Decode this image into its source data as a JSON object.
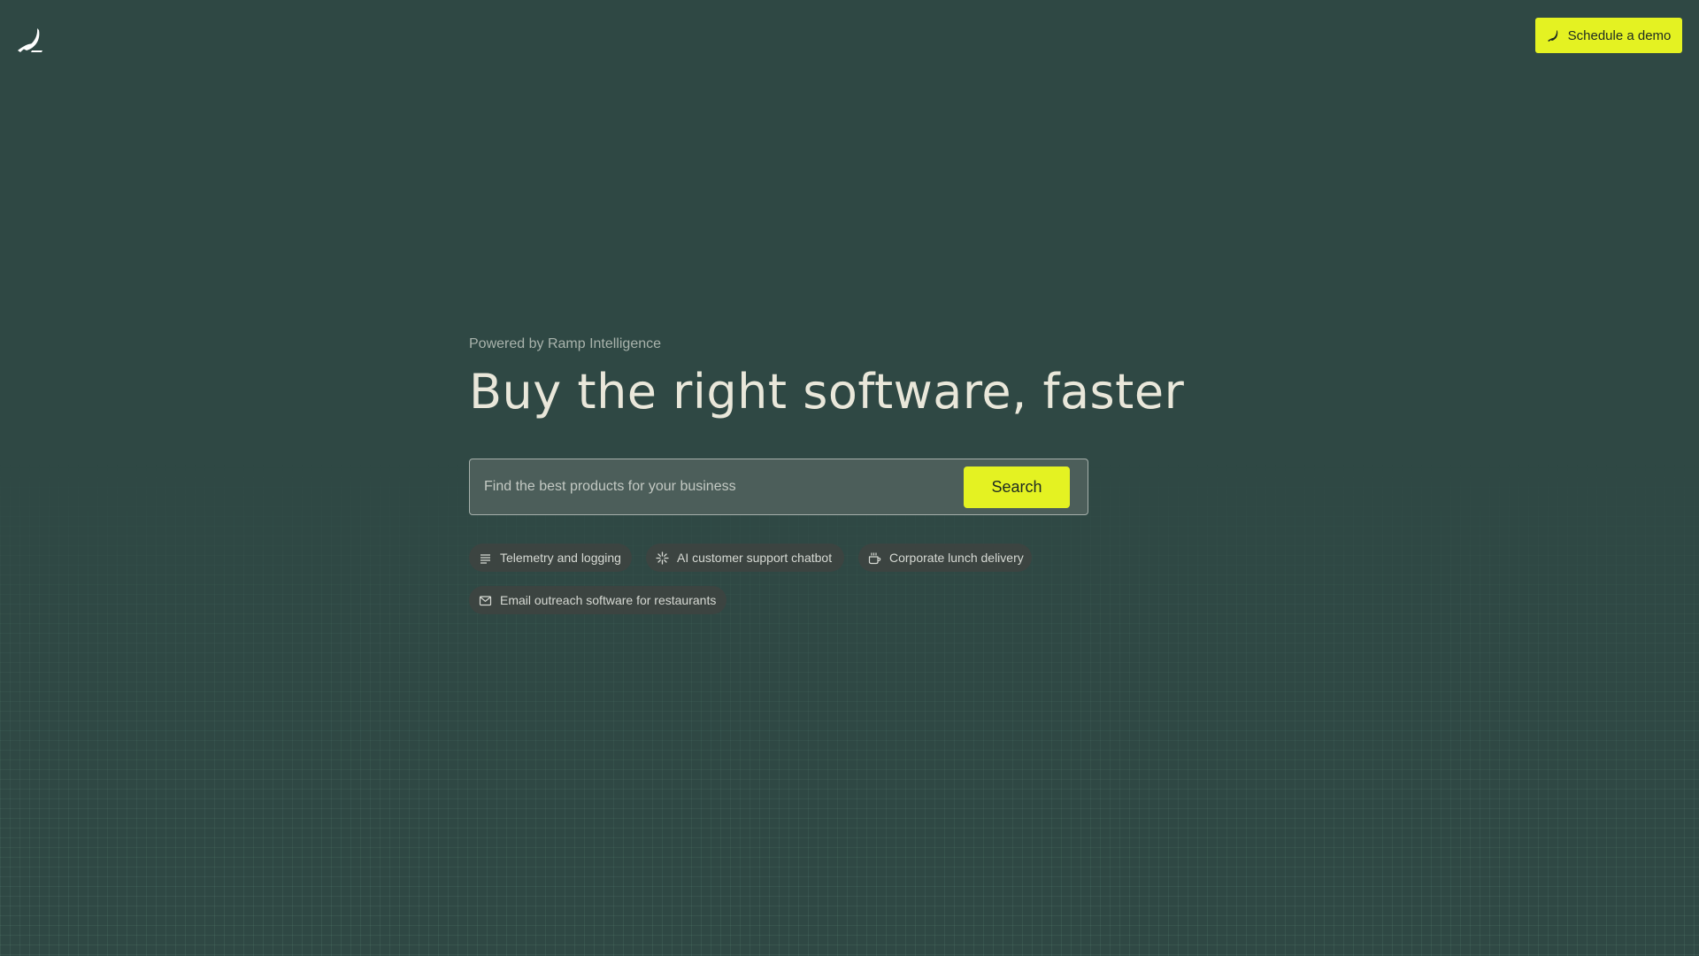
{
  "header": {
    "logo_icon": "ramp-logo-icon",
    "demo_button": {
      "label": "Schedule a demo",
      "icon": "ramp-logo-icon"
    }
  },
  "hero": {
    "powered_by": "Powered by Ramp Intelligence",
    "headline": "Buy the right software, faster"
  },
  "search": {
    "placeholder": "Find the best products for your business",
    "value": "",
    "button_label": "Search"
  },
  "suggestions": [
    {
      "label": "Telemetry and logging",
      "icon": "list-lines-icon"
    },
    {
      "label": "AI customer support chatbot",
      "icon": "sparkle-icon"
    },
    {
      "label": "Corporate lunch delivery",
      "icon": "takeout-cup-icon"
    },
    {
      "label": "Email outreach software for restaurants",
      "icon": "envelope-icon"
    }
  ],
  "colors": {
    "background": "#2f4844",
    "accent": "#e4f222",
    "chip_background": "#3c4441",
    "search_background": "#4c5e5a"
  }
}
